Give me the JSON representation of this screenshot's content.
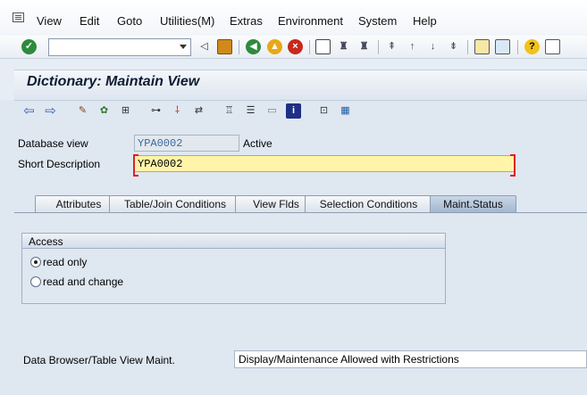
{
  "menu": {
    "items": [
      "View",
      "Edit",
      "Goto",
      "Utilities(M)",
      "Extras",
      "Environment",
      "System",
      "Help"
    ]
  },
  "toolbar": {
    "command_value": ""
  },
  "header": {
    "title": "Dictionary: Maintain View"
  },
  "form": {
    "database_view_label": "Database view",
    "database_view_value": "YPA0002",
    "status_value": "Active",
    "short_description_label": "Short Description",
    "short_description_value": "YPA0002"
  },
  "tabs": [
    {
      "label": "Attributes"
    },
    {
      "label": "Table/Join Conditions"
    },
    {
      "label": "View Flds"
    },
    {
      "label": "Selection Conditions"
    },
    {
      "label": "Maint.Status"
    }
  ],
  "access": {
    "title": "Access",
    "options": [
      {
        "label": "read only",
        "selected": true
      },
      {
        "label": "read and change",
        "selected": false
      }
    ]
  },
  "maintenance": {
    "label": "Data Browser/Table View Maint.",
    "value": "Display/Maintenance Allowed with Restrictions"
  },
  "colors": {
    "required_field_bg": "#fff4a8",
    "active_tab_bg": "#9fb4ce",
    "readonly_text": "#3b6a98"
  }
}
